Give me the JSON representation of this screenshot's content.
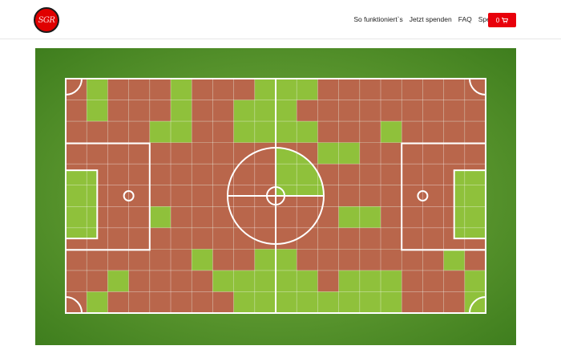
{
  "header": {
    "logo_text": "SGR",
    "nav": [
      "So funktioniert`s",
      "Jetzt spenden",
      "FAQ",
      "Spenderliste"
    ],
    "cart_count": "0",
    "cart_icon": "shopping-cart-icon"
  },
  "colors": {
    "grass": "#5e9c2c",
    "sold": "#b9664b",
    "free": "#8fc13b",
    "line": "#ffffff",
    "brand_red": "#e8000b"
  },
  "pitch": {
    "cols": 20,
    "rows": 11,
    "green_cells": [
      [
        0,
        1
      ],
      [
        0,
        5
      ],
      [
        0,
        9
      ],
      [
        0,
        10
      ],
      [
        0,
        11
      ],
      [
        1,
        1
      ],
      [
        1,
        5
      ],
      [
        1,
        8
      ],
      [
        1,
        9
      ],
      [
        1,
        10
      ],
      [
        2,
        4
      ],
      [
        2,
        5
      ],
      [
        2,
        8
      ],
      [
        2,
        9
      ],
      [
        2,
        10
      ],
      [
        2,
        11
      ],
      [
        2,
        15
      ],
      [
        3,
        12
      ],
      [
        3,
        13
      ],
      [
        6,
        4
      ],
      [
        6,
        13
      ],
      [
        6,
        14
      ],
      [
        8,
        6
      ],
      [
        8,
        9
      ],
      [
        8,
        10
      ],
      [
        8,
        18
      ],
      [
        9,
        2
      ],
      [
        9,
        7
      ],
      [
        9,
        8
      ],
      [
        9,
        9
      ],
      [
        9,
        10
      ],
      [
        9,
        11
      ],
      [
        9,
        13
      ],
      [
        9,
        14
      ],
      [
        9,
        15
      ],
      [
        9,
        19
      ],
      [
        10,
        1
      ],
      [
        10,
        8
      ],
      [
        10,
        9
      ],
      [
        10,
        10
      ],
      [
        10,
        11
      ],
      [
        10,
        12
      ],
      [
        10,
        13
      ],
      [
        10,
        14
      ],
      [
        10,
        15
      ],
      [
        10,
        19
      ]
    ],
    "center_sold_fraction": 0.75
  }
}
